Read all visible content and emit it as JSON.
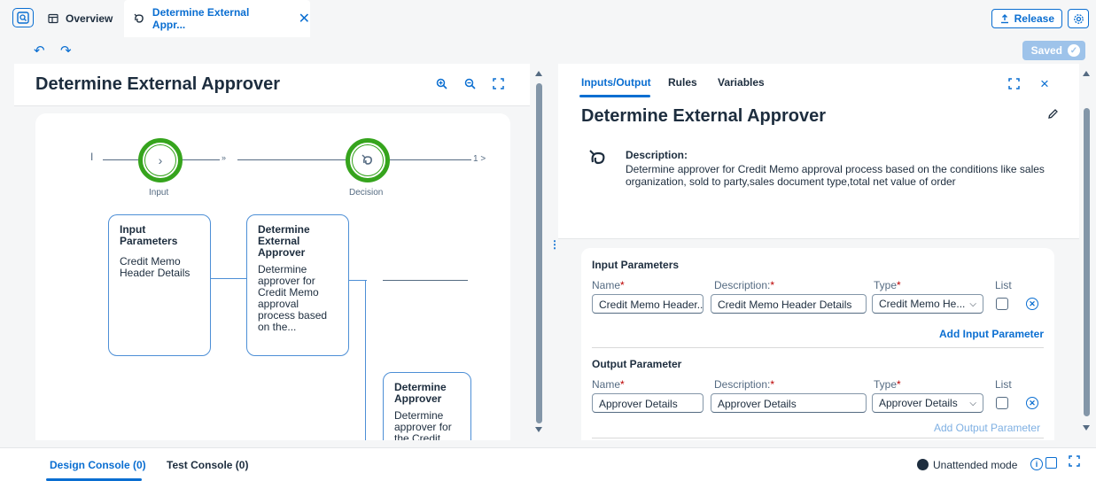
{
  "tabs": {
    "overview_label": "Overview",
    "active_label": "Determine External Appr...",
    "close_glyph": "✕"
  },
  "toolbar": {
    "release_label": "Release",
    "saved_label": "Saved"
  },
  "left_panel": {
    "title": "Determine External Approver",
    "flow": {
      "start_marker": "I",
      "chevrons": "»",
      "end_marker": "1 >",
      "nodes": [
        {
          "label": "Input"
        },
        {
          "label": "Decision"
        }
      ],
      "cards": [
        {
          "title": "Input Parameters",
          "body": "Credit Memo Header Details"
        },
        {
          "title": "Determine External Approver",
          "body": "Determine approver for Credit Memo approval process based on the..."
        },
        {
          "title": "Determine Approver",
          "body": "Determine approver for the Credit M..."
        }
      ]
    }
  },
  "right_panel": {
    "title": "Determine External Approver",
    "description_label": "Description:",
    "description": "Determine approver for Credit Memo approval process based on the conditions like sales organization, sold to party,sales document type,total net value of order",
    "tabs": [
      "Inputs/Output",
      "Rules",
      "Variables"
    ],
    "input_section": {
      "title": "Input Parameters",
      "col_name": "Name",
      "col_desc": "Description:",
      "col_type": "Type",
      "col_list": "List",
      "row": {
        "name": "Credit Memo Header...",
        "description": "Credit Memo Header Details",
        "type": "Credit Memo He..."
      },
      "add_label": "Add Input Parameter"
    },
    "output_section": {
      "title": "Output Parameter",
      "col_name": "Name",
      "col_desc": "Description:",
      "col_type": "Type",
      "col_list": "List",
      "row": {
        "name": "Approver Details",
        "description": "Approver Details",
        "type": "Approver Details"
      },
      "add_label": "Add Output Parameter"
    },
    "required_marker": "*"
  },
  "bottom_bar": {
    "design_console": "Design Console (0)",
    "test_console": "Test Console (0)",
    "mode_label": "Unattended mode"
  },
  "colors": {
    "accent": "#0a6ed1",
    "success": "#36a41d",
    "required": "#bb0000"
  }
}
